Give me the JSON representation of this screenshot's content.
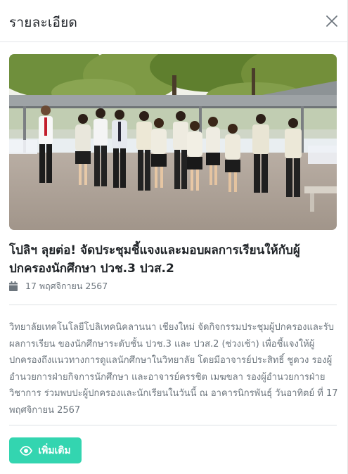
{
  "modal": {
    "title": "รายละเอียด",
    "close_icon": "close-icon"
  },
  "article": {
    "photo_icon": "group-photo",
    "headline": "โปลิฯ ลุยต่อ! จัดประชุมชี้แจงและมอบผลการเรียนให้กับผู้ปกครองนักศึกษา ปวช.3 ปวส.2",
    "date_icon": "calendar-icon",
    "date": "17 พฤศจิกายน 2567",
    "body": "วิทยาลัยเทคโนโลยีโปลิเทคนิคลานนา เชียงใหม่ จัดกิจกรรมประชุมผู้ปกครองและรับผลการเรียน ของนักศึกษาระดับชั้น ปวช.3 และ ปวส.2 (ช่วงเช้า) เพื่อชี้แจงให้ผู้ปกครองถึงแนวทางการดูแลนักศึกษาในวิทยาลัย โดยมีอาจารย์ประสิทธิ์ ชูดวง รองผู้อำนวยการฝ่ายกิจการนักศึกษา และอาจารย์ครรชิต เมฆขลา รองผู้อำนวยการฝ่ายวิชาการ ร่วมพบปะผู้ปกครองและนักเรียนในวันนี้ ณ อาคารนิกรพันธุ์ วันอาทิตย์ ที่ 17 พฤศจิกายน 2567"
  },
  "actions": {
    "more_label": "เพิ่มเติม",
    "more_icon": "eye-icon",
    "button_color": "#33d5b0"
  }
}
